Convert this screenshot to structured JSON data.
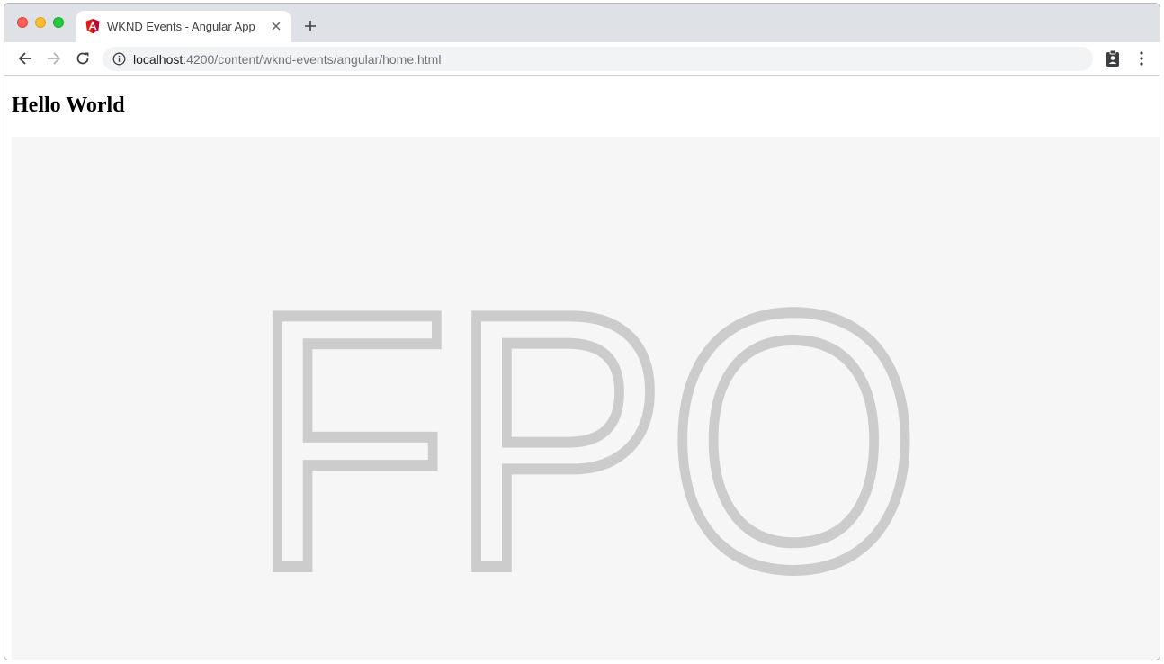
{
  "browser": {
    "tab": {
      "title": "WKND Events - Angular App",
      "favicon": "angular-logo-icon"
    },
    "new_tab_icon": "plus-icon",
    "toolbar": {
      "back_icon": "arrow-left-icon",
      "forward_icon": "arrow-right-icon",
      "reload_icon": "reload-icon",
      "url_host": "localhost",
      "url_rest": ":4200/content/wknd-events/angular/home.html",
      "info_icon": "info-icon",
      "extension_icon": "clipboard-account-icon",
      "menu_icon": "kebab-menu-icon"
    }
  },
  "page": {
    "heading": "Hello World",
    "placeholder_text": "FPO"
  },
  "colors": {
    "tabstrip": "#dee1e6",
    "placeholder_bg": "#f6f6f6",
    "placeholder_text": "#cccccc",
    "angular_red": "#dd1b16"
  }
}
